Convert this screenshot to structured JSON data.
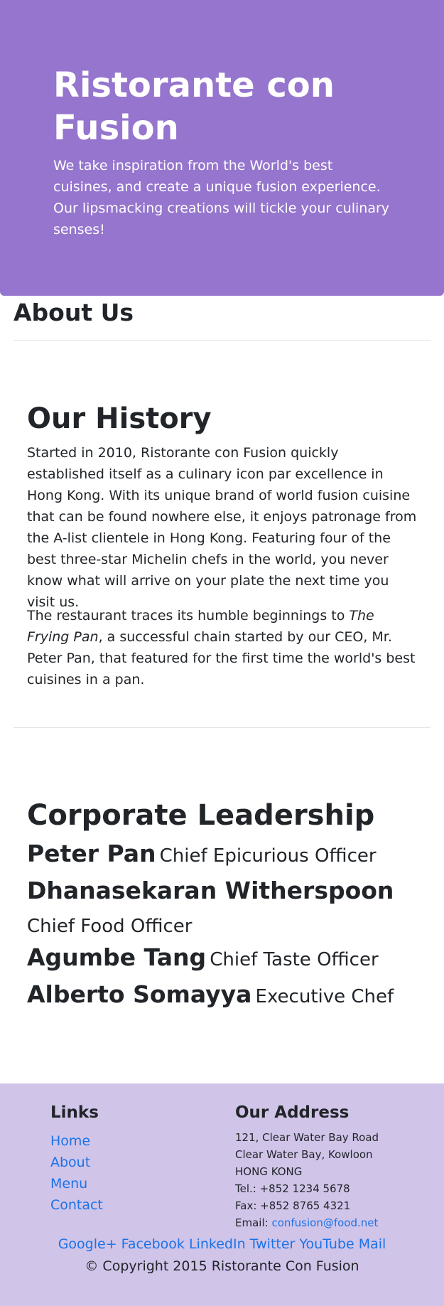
{
  "hero": {
    "title": "Ristorante con Fusion",
    "tagline": "We take inspiration from the World's best cuisines, and create a unique fusion experience. Our lipsmacking creations will tickle your culinary senses!"
  },
  "about": {
    "title": "About Us"
  },
  "history": {
    "title": "Our History",
    "paragraph1": "Started in 2010, Ristorante con Fusion quickly established itself as a culinary icon par excellence in Hong Kong. With its unique brand of world fusion cuisine that can be found nowhere else, it enjoys patronage from the A-list clientele in Hong Kong. Featuring four of the best three-star Michelin chefs in the world, you never know what will arrive on your plate the next time you visit us.",
    "paragraph2_before": "The restaurant traces its humble beginnings to ",
    "paragraph2_em": "The Frying Pan",
    "paragraph2_after": ", a successful chain started by our CEO, Mr. Peter Pan, that featured for the first time the world's best cuisines in a pan."
  },
  "leadership": {
    "title": "Corporate Leadership",
    "leaders": [
      {
        "name": "Peter Pan",
        "role": "Chief Epicurious Officer"
      },
      {
        "name": "Dhanasekaran Witherspoon",
        "role": "Chief Food Officer"
      },
      {
        "name": "Agumbe Tang",
        "role": "Chief Taste Officer"
      },
      {
        "name": "Alberto Somayya",
        "role": "Executive Chef"
      }
    ]
  },
  "footer": {
    "links_title": "Links",
    "links": [
      "Home",
      "About",
      "Menu",
      "Contact"
    ],
    "address_title": "Our Address",
    "address_lines": [
      "121, Clear Water Bay Road",
      "Clear Water Bay, Kowloon",
      "HONG KONG",
      "Tel.: +852 1234 5678",
      "Fax: +852 8765 4321"
    ],
    "email_label": "Email: ",
    "email": "confusion@food.net",
    "social": [
      "Google+",
      "Facebook",
      "LinkedIn",
      "Twitter",
      "YouTube",
      "Mail"
    ],
    "copyright": "© Copyright 2015 Ristorante Con Fusion"
  },
  "colors": {
    "hero_bg": "#9575cd",
    "footer_bg": "#d1c4e9",
    "link": "#1a73e8"
  }
}
